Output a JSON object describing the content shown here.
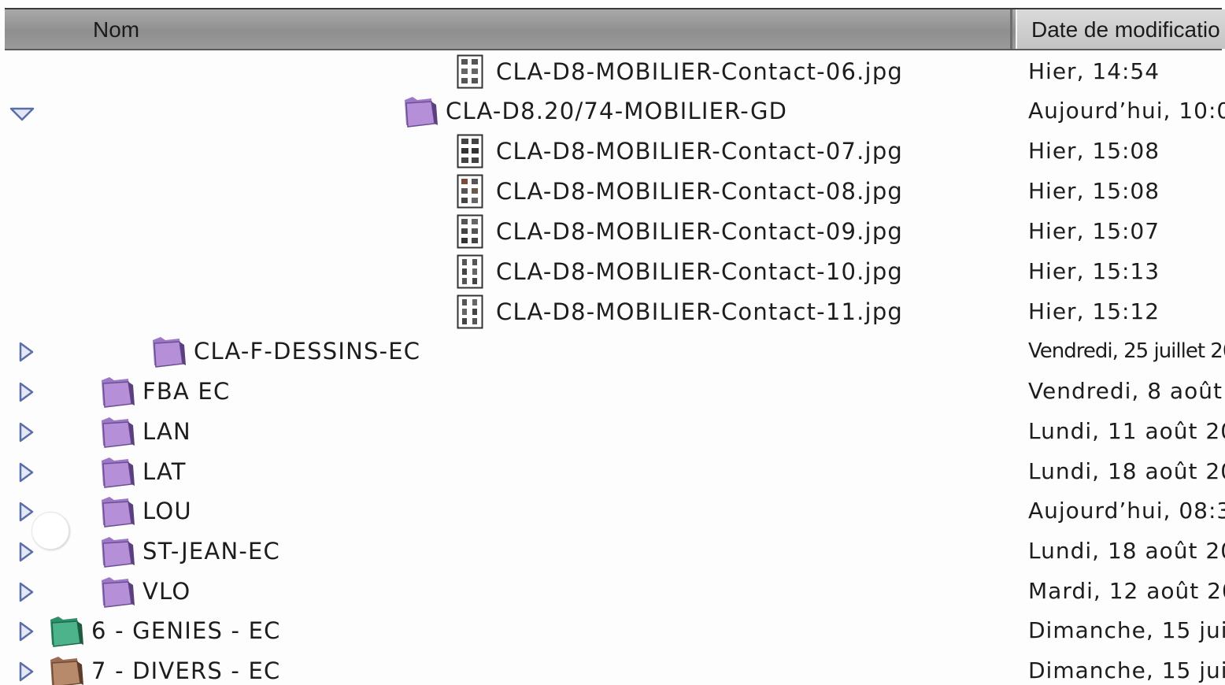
{
  "columns": {
    "name": "Nom",
    "date": "Date de modificatio"
  },
  "colors": {
    "folder_purple": "#b58fd8",
    "folder_green": "#4db38a",
    "folder_brown": "#b88a6c",
    "disclosure_blue": "#7a8fd0"
  },
  "rows": [
    {
      "name": "CLA-D8-MOBILIER-Contact-06.jpg",
      "date": "Hier, 14:54",
      "icon": "image-file-icon"
    },
    {
      "name": "CLA-D8.20/74-MOBILIER-GD",
      "date": "Aujourd’hui, 10:0",
      "icon": "folder-icon",
      "disclosure": "expanded"
    },
    {
      "name": "CLA-D8-MOBILIER-Contact-07.jpg",
      "date": "Hier, 15:08",
      "icon": "image-file-icon"
    },
    {
      "name": "CLA-D8-MOBILIER-Contact-08.jpg",
      "date": "Hier, 15:08",
      "icon": "image-file-icon"
    },
    {
      "name": "CLA-D8-MOBILIER-Contact-09.jpg",
      "date": "Hier, 15:07",
      "icon": "image-file-icon"
    },
    {
      "name": "CLA-D8-MOBILIER-Contact-10.jpg",
      "date": "Hier, 15:13",
      "icon": "image-file-icon"
    },
    {
      "name": "CLA-D8-MOBILIER-Contact-11.jpg",
      "date": "Hier, 15:12",
      "icon": "image-file-icon"
    },
    {
      "name": "CLA-F-DESSINS-EC",
      "date": "Vendredi, 25 juillet 20",
      "icon": "folder-icon",
      "disclosure": "collapsed"
    },
    {
      "name": "FBA EC",
      "date": "Vendredi, 8 août 2",
      "icon": "folder-icon",
      "disclosure": "collapsed"
    },
    {
      "name": "LAN",
      "date": "Lundi, 11 août 20",
      "icon": "folder-icon",
      "disclosure": "collapsed"
    },
    {
      "name": "LAT",
      "date": "Lundi, 18 août 20",
      "icon": "folder-icon",
      "disclosure": "collapsed"
    },
    {
      "name": "LOU",
      "date": "Aujourd’hui, 08:3",
      "icon": "folder-icon",
      "disclosure": "collapsed"
    },
    {
      "name": "ST-JEAN-EC",
      "date": "Lundi, 18 août 20",
      "icon": "folder-icon",
      "disclosure": "collapsed"
    },
    {
      "name": "VLO",
      "date": "Mardi, 12 août 20",
      "icon": "folder-icon",
      "disclosure": "collapsed"
    },
    {
      "name": "6 - GENIES - EC",
      "date": "Dimanche, 15 juin",
      "icon": "folder-icon",
      "disclosure": "collapsed"
    },
    {
      "name": "7 - DIVERS - EC",
      "date": "Dimanche, 15 juin",
      "icon": "folder-icon",
      "disclosure": "collapsed"
    }
  ]
}
